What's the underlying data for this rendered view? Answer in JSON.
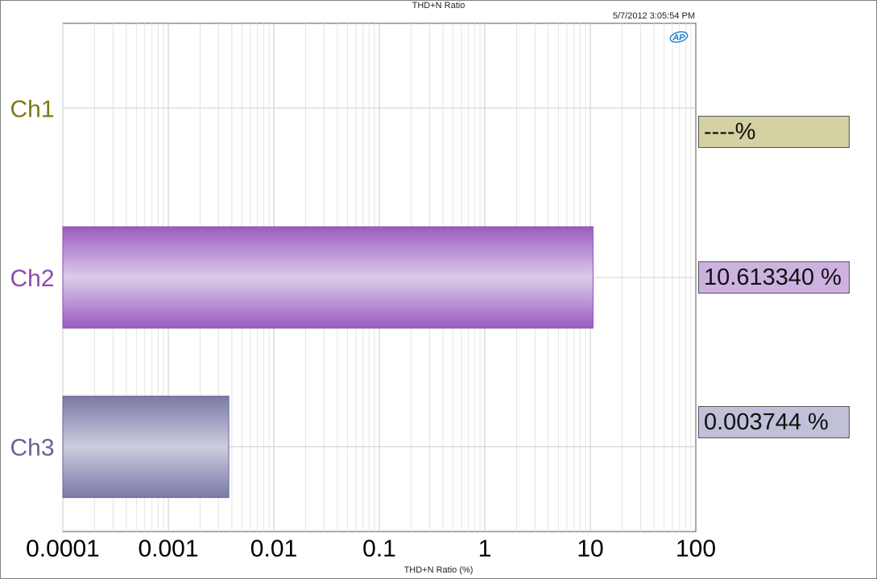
{
  "header": {
    "title": "THD+N Ratio",
    "timestamp": "5/7/2012 3:05:54 PM",
    "logo_text": "AP"
  },
  "colors": {
    "ch1": "#7f7a14",
    "ch2": "#8e48b4",
    "ch3": "#646496",
    "ch1_box": "#d4d1a2",
    "ch2_box": "#cdb2e0",
    "ch3_box": "#c0c0d8",
    "logo": "#1a7fd0"
  },
  "chart_data": {
    "type": "bar",
    "orientation": "horizontal",
    "title": "THD+N Ratio",
    "xlabel": "THD+N Ratio (%)",
    "ylabel": "",
    "xscale": "log",
    "xlim": [
      0.0001,
      100
    ],
    "xticks": [
      "0.0001",
      "0.001",
      "0.01",
      "0.1",
      "1",
      "10",
      "100"
    ],
    "grid": true,
    "categories": [
      "Ch1",
      "Ch2",
      "Ch3"
    ],
    "values": [
      null,
      10.61334,
      0.003744
    ],
    "readouts": [
      "----%",
      "10.613340 %",
      "0.003744 %"
    ]
  }
}
